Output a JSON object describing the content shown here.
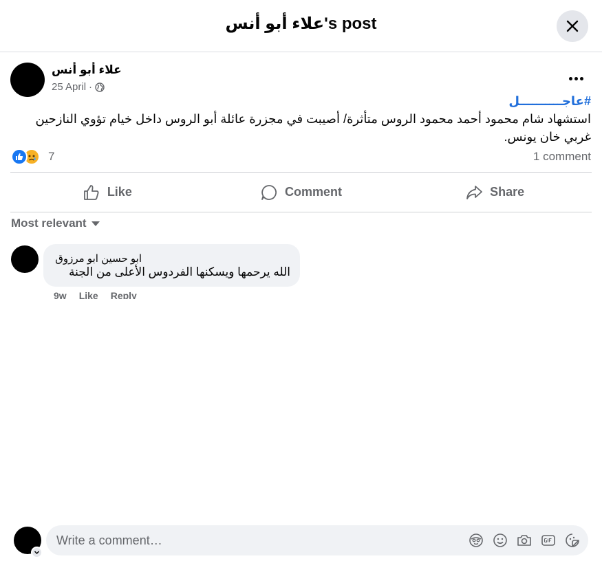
{
  "header": {
    "title": "علاء أبو أنس's post"
  },
  "post": {
    "author": "علاء أبو أنس",
    "date": "25 April",
    "meta_separator": "·",
    "hashtag": "#عاجــــــــــل",
    "text": "استشهاد شام محمود أحمد محمود الروس متأثرة/ أصيبت في مجزرة عائلة أبو الروس داخل خيام تؤوي النازحين غربي خان يونس.",
    "reaction_count": "7",
    "comment_count": "1 comment",
    "reactions": [
      "like-icon",
      "sad-icon"
    ]
  },
  "actions": {
    "like": "Like",
    "comment": "Comment",
    "share": "Share"
  },
  "comments_sort": "Most relevant",
  "comments": [
    {
      "author": "ابو حسين ابو مرزوق",
      "text": "الله يرحمها ويسكنها الفردوس الأعلى من الجنة",
      "time": "9w",
      "like": "Like",
      "reply": "Reply"
    }
  ],
  "composer": {
    "placeholder": "Write a comment…",
    "icons": [
      "avatar-sticker-icon",
      "emoji-icon",
      "camera-icon",
      "gif-icon",
      "sticker-icon"
    ]
  },
  "colors": {
    "link": "#216fdb",
    "secondary_text": "#65676b",
    "like_blue": "#1877f2",
    "bubble_bg": "#f0f2f5"
  }
}
